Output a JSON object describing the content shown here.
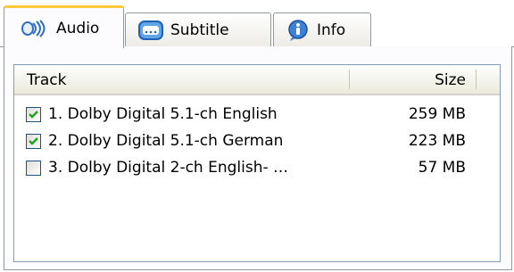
{
  "tabs": [
    {
      "label": "Audio",
      "icon": "audio-icon",
      "active": true
    },
    {
      "label": "Subtitle",
      "icon": "subtitle-icon",
      "active": false
    },
    {
      "label": "Info",
      "icon": "info-icon",
      "active": false
    }
  ],
  "table": {
    "columns": {
      "track": "Track",
      "size": "Size"
    },
    "rows": [
      {
        "label": "1. Dolby Digital 5.1-ch English",
        "size": "259 MB",
        "checked": true
      },
      {
        "label": "2. Dolby Digital 5.1-ch German",
        "size": "223 MB",
        "checked": true
      },
      {
        "label": "3. Dolby Digital 2-ch English- …",
        "size": "57 MB",
        "checked": false
      }
    ]
  },
  "colors": {
    "active_tab_accent": "#ffc83c",
    "border": "#919b9c",
    "checkmark": "#21a121",
    "checkbox_border": "#1c5180"
  }
}
